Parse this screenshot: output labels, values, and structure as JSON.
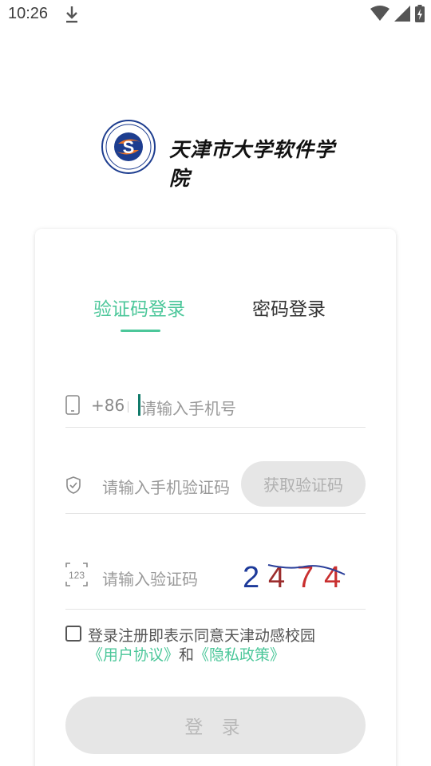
{
  "status_bar": {
    "time": "10:26",
    "icons": [
      "download-icon",
      "wifi-icon",
      "signal-icon",
      "battery-icon"
    ]
  },
  "logo": {
    "emblem_letter": "S",
    "title": "天津市大学软件学院"
  },
  "tabs": [
    {
      "label": "验证码登录",
      "active": true
    },
    {
      "label": "密码登录",
      "active": false
    }
  ],
  "phone": {
    "prefix": "+86",
    "placeholder": "请输入手机号",
    "value": ""
  },
  "sms_code": {
    "placeholder": "请输入手机验证码",
    "button_label": "获取验证码"
  },
  "captcha": {
    "placeholder": "请输入验证码",
    "digits": [
      "2",
      "4",
      "7",
      "4"
    ]
  },
  "agreement": {
    "checked": false,
    "text": "登录注册即表示同意天津动感校园",
    "link_user": "《用户协议》",
    "and": "和",
    "link_privacy": "《隐私政策》"
  },
  "login_button": "登 录",
  "colors": {
    "accent": "#4cc79a",
    "disabled_bg": "#e6e6e6",
    "disabled_text": "#b9b9b9"
  }
}
